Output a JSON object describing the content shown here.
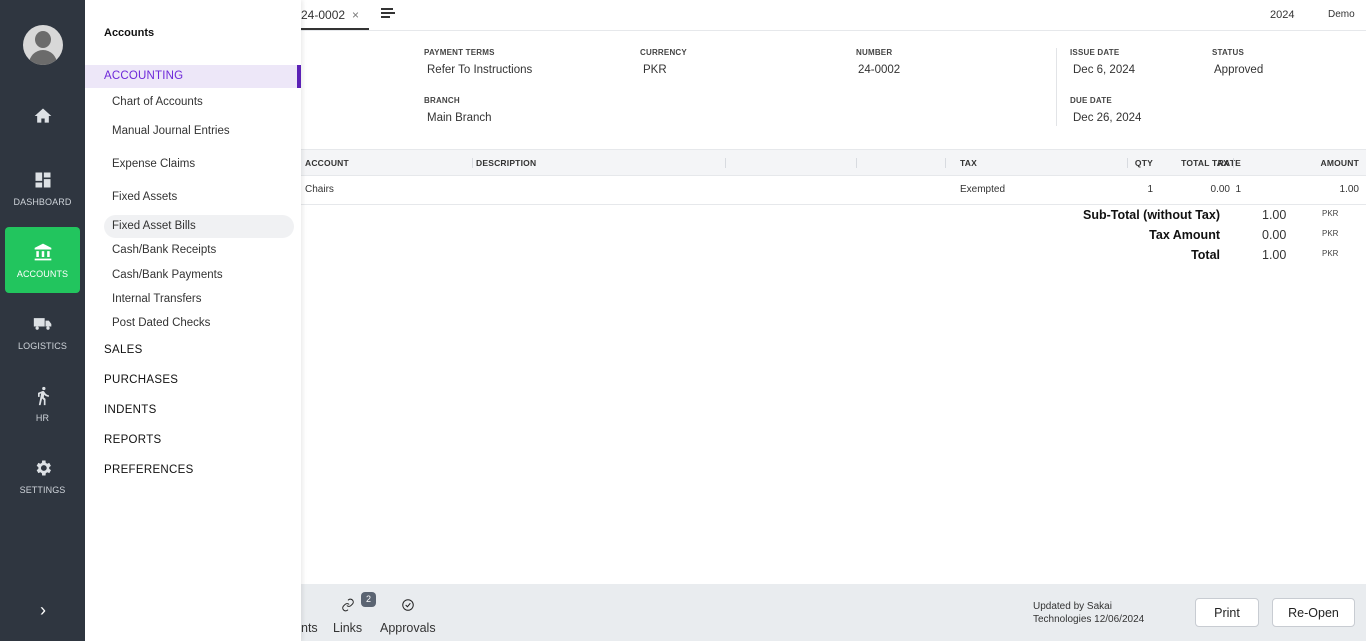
{
  "rail": {
    "items": [
      {
        "label": "",
        "icon": "home-icon"
      },
      {
        "label": "DASHBOARD",
        "icon": "dashboard-icon"
      },
      {
        "label": "ACCOUNTS",
        "icon": "bank-icon",
        "active": true
      },
      {
        "label": "LOGISTICS",
        "icon": "truck-icon"
      },
      {
        "label": "HR",
        "icon": "person-walking-icon"
      },
      {
        "label": "SETTINGS",
        "icon": "gear-icon"
      }
    ],
    "active_color": "#22c55e",
    "background": "#2f3640"
  },
  "menu": {
    "title": "Accounts",
    "active_section": "ACCOUNTING",
    "accounting_items": [
      "Chart of Accounts",
      "Manual Journal Entries",
      "Expense Claims",
      "Fixed Assets",
      "Fixed Asset Bills",
      "Cash/Bank Receipts",
      "Cash/Bank Payments",
      "Internal Transfers",
      "Post Dated Checks"
    ],
    "sections": [
      "SALES",
      "PURCHASES",
      "INDENTS",
      "REPORTS",
      "PREFERENCES"
    ],
    "accent_color": "#5b21b6"
  },
  "tabs": {
    "active_label": "24-0002",
    "close": "×"
  },
  "header": {
    "year": "2024",
    "company": "Demo"
  },
  "fields": {
    "payment_terms": {
      "label": "PAYMENT TERMS",
      "value": "Refer To Instructions"
    },
    "currency": {
      "label": "CURRENCY",
      "value": "PKR"
    },
    "number": {
      "label": "NUMBER",
      "value": "24-0002"
    },
    "issue_date": {
      "label": "ISSUE DATE",
      "value": "Dec 6, 2024"
    },
    "status": {
      "label": "STATUS",
      "value": "Approved"
    },
    "branch": {
      "label": "BRANCH",
      "value": "Main Branch"
    },
    "due_date": {
      "label": "DUE DATE",
      "value": "Dec 26, 2024"
    }
  },
  "table": {
    "headers": {
      "account": "ACCOUNT",
      "description": "DESCRIPTION",
      "qty": "QTY",
      "rate": "RATE",
      "tax": "TAX",
      "total_tax": "TOTAL TAX",
      "amount": "AMOUNT"
    },
    "rows": [
      {
        "account": "Chairs",
        "description": "",
        "qty": "1",
        "rate": "1",
        "tax": "Exempted",
        "total_tax": "0.00",
        "amount": "1.00"
      }
    ]
  },
  "totals": {
    "subtotal": {
      "label": "Sub-Total (without Tax)",
      "value": "1.00",
      "currency": "PKR"
    },
    "tax": {
      "label": "Tax Amount",
      "value": "0.00",
      "currency": "PKR"
    },
    "total": {
      "label": "Total",
      "value": "1.00",
      "currency": "PKR"
    }
  },
  "footer": {
    "fragment": "nts",
    "links_label": "Links",
    "links_count": "2",
    "approvals_label": "Approvals",
    "updated_line1": "Updated by Sakai",
    "updated_line2": "Technologies 12/06/2024",
    "print": "Print",
    "reopen": "Re-Open"
  }
}
